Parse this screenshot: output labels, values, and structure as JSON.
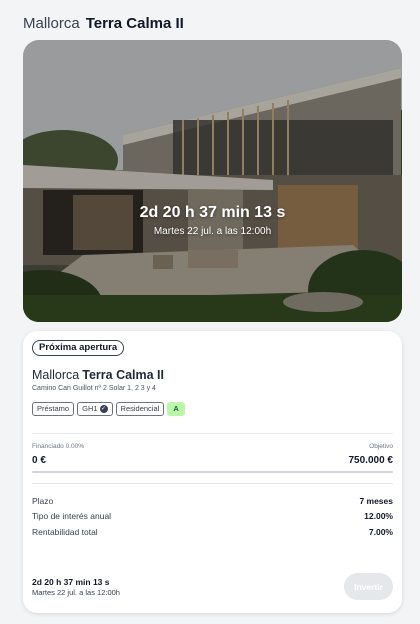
{
  "header": {
    "region": "Mallorca",
    "name": "Terra Calma II"
  },
  "hero": {
    "countdown": "2d 20 h 37 min 13 s",
    "opening_date": "Martes 22 jul. a las 12:00h"
  },
  "card": {
    "badge": "Próxima apertura",
    "region": "Mallorca",
    "name": "Terra Calma II",
    "address": "Camino Can Guillot nº 2 Solar 1, 2 3 y 4",
    "tags": {
      "type": "Préstamo",
      "guarantee": "GH1",
      "use": "Residencial",
      "rating": "A"
    },
    "funded_label": "Financiado 0.00%",
    "objective_label": "Objetivo",
    "funded_value": "0 €",
    "objective_value": "750.000 €",
    "progress_fraction": 0,
    "term_label": "Plazo",
    "term_value": "7 meses",
    "rate_label": "Tipo de interés anual",
    "rate_value": "12.00%",
    "return_label": "Rentabilidad total",
    "return_value": "7.00%",
    "countdown": "2d 20 h 37 min 13 s",
    "opening_date": "Martes 22 jul. a las 12:00h",
    "invest_label": "Invertir"
  },
  "colors": {
    "rating_bg": "#bbf7a8",
    "button_disabled": "#e5e7eb",
    "text_dark": "#111827"
  }
}
